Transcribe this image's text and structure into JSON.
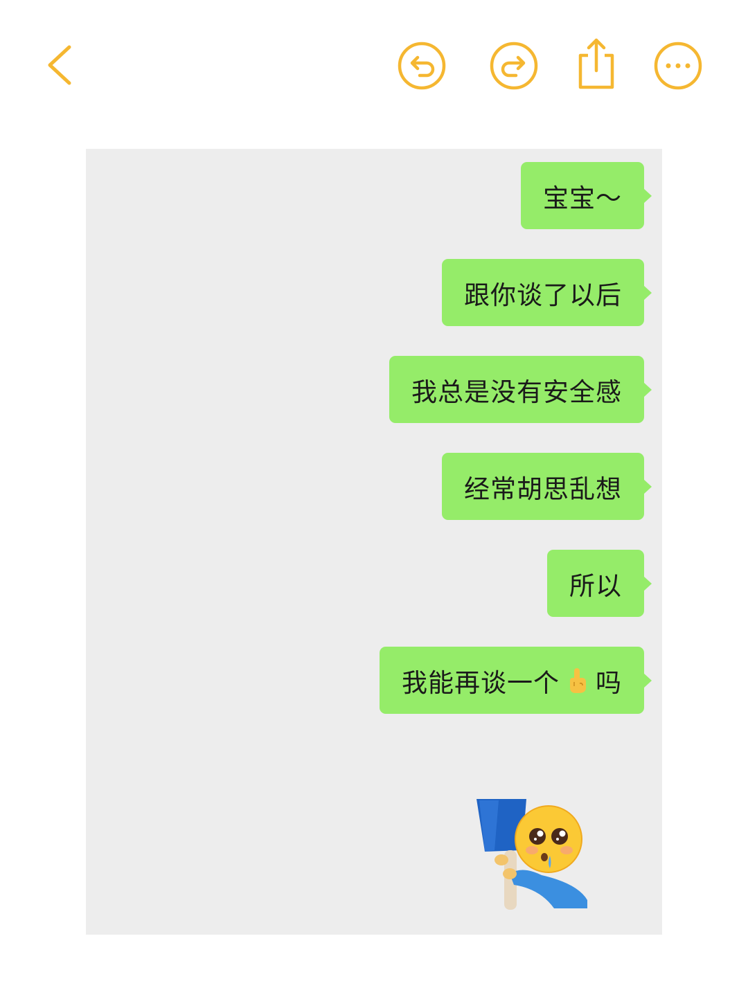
{
  "toolbar": {
    "back_icon": "chevron-left-icon",
    "undo_icon": "undo-icon",
    "redo_icon": "redo-icon",
    "share_icon": "share-icon",
    "more_icon": "more-icon",
    "accent_color": "#f5b731"
  },
  "chat": {
    "background_color": "#ededed",
    "bubble_color": "#95ec69",
    "messages": [
      {
        "text": "宝宝～"
      },
      {
        "text": "跟你谈了以后"
      },
      {
        "text": "我总是没有安全感"
      },
      {
        "text": "经常胡思乱想"
      },
      {
        "text": "所以"
      },
      {
        "text_before": "我能再谈一个",
        "emoji": "pointing-up-hand-emoji",
        "text_after": "吗"
      }
    ],
    "sticker": "crying-face-holding-sign-sticker"
  }
}
